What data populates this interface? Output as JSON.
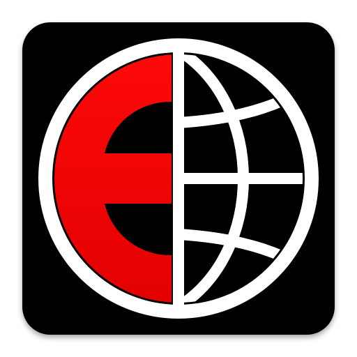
{
  "icon": {
    "name": "globe-e-logo",
    "colors": {
      "background": "#000000",
      "red": "#ff0a0a",
      "red_dark": "#e00000",
      "white": "#ffffff"
    }
  }
}
